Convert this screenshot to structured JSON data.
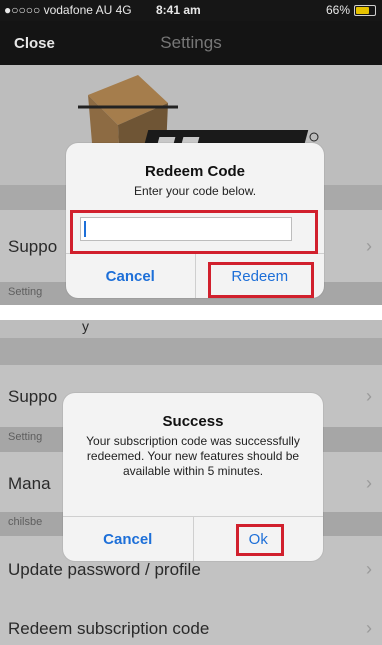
{
  "status_bar": {
    "carrier": "●○○○○ vodafone AU  4G",
    "time": "8:41 am",
    "battery": "66%"
  },
  "nav": {
    "close_label": "Close",
    "title": "Settings"
  },
  "shot1": {
    "rows": [
      {
        "label": "Suppo"
      }
    ],
    "footer_label": "Setting",
    "dialog": {
      "title": "Redeem Code",
      "message": "Enter your code below.",
      "input_value": "",
      "cancel_label": "Cancel",
      "confirm_label": "Redeem"
    }
  },
  "shot2": {
    "top_fragment": "y",
    "rows": [
      {
        "label": "Suppo"
      },
      {
        "label": "Mana"
      },
      {
        "label": "Update password / profile"
      },
      {
        "label": "Redeem subscription code"
      }
    ],
    "footers": [
      "Setting",
      "chilsbe"
    ],
    "dialog": {
      "title": "Success",
      "message": "Your subscription code was successfully redeemed. Your new features should be available within 5 minutes.",
      "cancel_label": "Cancel",
      "confirm_label": "Ok"
    }
  },
  "icons": {
    "chevron": "chevron-right-icon",
    "logo": "felenix-logo"
  },
  "colors": {
    "highlight": "#d1202d",
    "ios_blue": "#1d6fd8",
    "battery": "#e6c200"
  }
}
